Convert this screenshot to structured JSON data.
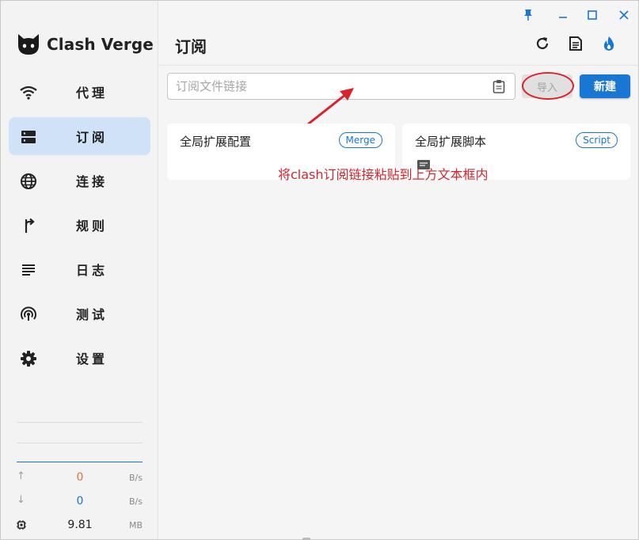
{
  "app": {
    "name": "Clash Verge"
  },
  "sidebar": {
    "items": [
      {
        "label": "代理",
        "icon": "wifi-icon",
        "active": false
      },
      {
        "label": "订阅",
        "icon": "server-icon",
        "active": true
      },
      {
        "label": "连接",
        "icon": "globe-icon",
        "active": false
      },
      {
        "label": "规则",
        "icon": "fork-icon",
        "active": false
      },
      {
        "label": "日志",
        "icon": "list-icon",
        "active": false
      },
      {
        "label": "测试",
        "icon": "radar-icon",
        "active": false
      },
      {
        "label": "设置",
        "icon": "gear-icon",
        "active": false
      }
    ],
    "traffic": {
      "upload": {
        "value": "0",
        "unit": "B/s",
        "color": "#e0733a"
      },
      "download": {
        "value": "0",
        "unit": "B/s",
        "color": "#1976d2"
      },
      "memory": {
        "value": "9.81",
        "unit": "MB"
      }
    }
  },
  "titlebar": {
    "buttons": [
      "pin-icon",
      "minimize-icon",
      "maximize-icon",
      "close-icon"
    ]
  },
  "main": {
    "title": "订阅",
    "header_buttons": [
      "refresh-icon",
      "document-icon",
      "flame-icon"
    ],
    "url_input": {
      "placeholder": "订阅文件链接",
      "value": ""
    },
    "import_label": "导入",
    "new_label": "新建",
    "cards": [
      {
        "title": "全局扩展配置",
        "chip": "Merge"
      },
      {
        "title": "全局扩展脚本",
        "chip": "Script"
      }
    ],
    "annotation": "将clash订阅链接粘贴到上方文本框内"
  },
  "colors": {
    "accent": "#1976d2",
    "annotation_red": "#d9232b",
    "active_nav": "#cfe2f7"
  }
}
